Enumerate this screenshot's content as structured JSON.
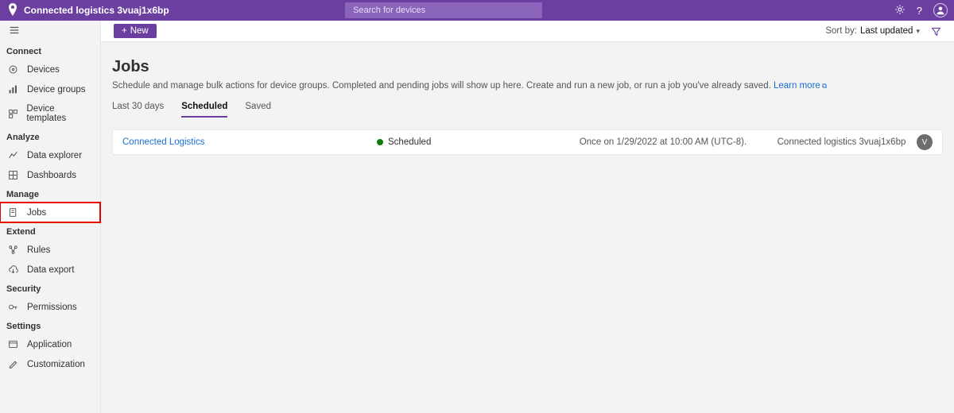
{
  "header": {
    "app_title": "Connected logistics 3vuaj1x6bp",
    "search_placeholder": "Search for devices"
  },
  "sidebar": {
    "groups": [
      {
        "label": "Connect",
        "items": [
          {
            "icon": "devices",
            "label": "Devices"
          },
          {
            "icon": "groups",
            "label": "Device groups"
          },
          {
            "icon": "template",
            "label": "Device templates"
          }
        ]
      },
      {
        "label": "Analyze",
        "items": [
          {
            "icon": "chart",
            "label": "Data explorer"
          },
          {
            "icon": "dash",
            "label": "Dashboards"
          }
        ]
      },
      {
        "label": "Manage",
        "items": [
          {
            "icon": "jobs",
            "label": "Jobs",
            "selected": true,
            "highlight": true
          }
        ]
      },
      {
        "label": "Extend",
        "items": [
          {
            "icon": "rules",
            "label": "Rules"
          },
          {
            "icon": "export",
            "label": "Data export"
          }
        ]
      },
      {
        "label": "Security",
        "items": [
          {
            "icon": "perm",
            "label": "Permissions"
          }
        ]
      },
      {
        "label": "Settings",
        "items": [
          {
            "icon": "app",
            "label": "Application"
          },
          {
            "icon": "cust",
            "label": "Customization"
          }
        ]
      }
    ]
  },
  "cmdbar": {
    "new_label": "New",
    "sort_prefix": "Sort by:",
    "sort_value": "Last updated"
  },
  "page": {
    "title": "Jobs",
    "description": "Schedule and manage bulk actions for device groups. Completed and pending jobs will show up here. Create and run a new job, or run a job you've already saved.",
    "learn_more": "Learn more"
  },
  "tabs": [
    {
      "label": "Last 30 days",
      "active": false
    },
    {
      "label": "Scheduled",
      "active": true
    },
    {
      "label": "Saved",
      "active": false
    }
  ],
  "jobs": [
    {
      "name": "Connected Logistics",
      "status": "Scheduled",
      "schedule": "Once on 1/29/2022 at 10:00 AM (UTC-8).",
      "org": "Connected logistics 3vuaj1x6bp",
      "avatar_initial": "V"
    }
  ]
}
